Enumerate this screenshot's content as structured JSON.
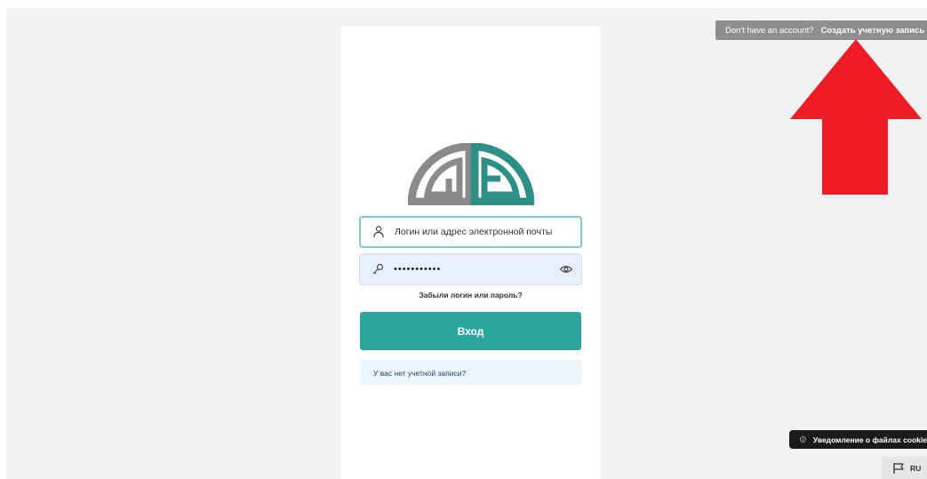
{
  "login_form": {
    "login_placeholder": "Логин или адрес электронной почты",
    "password_value": "•••••••••••",
    "forgot_link": "Забыли логин или пароль?",
    "submit_label": "Вход",
    "no_account_link": "У вас нет учетной записи?"
  },
  "signup_banner": {
    "prompt": "Don't have an account?",
    "link": "Создать учетную запись"
  },
  "cookie_notice": {
    "label": "Уведомление о файлах cookie"
  },
  "language": {
    "code": "RU"
  },
  "colors": {
    "accent": "#2ba59d",
    "logo_gray": "#8a8a8a",
    "logo_teal": "#2e8f86",
    "arrow": "#ee1c25"
  },
  "icons": [
    "user-icon",
    "key-icon",
    "eye-icon",
    "info-icon",
    "flag-icon",
    "red-arrow"
  ]
}
